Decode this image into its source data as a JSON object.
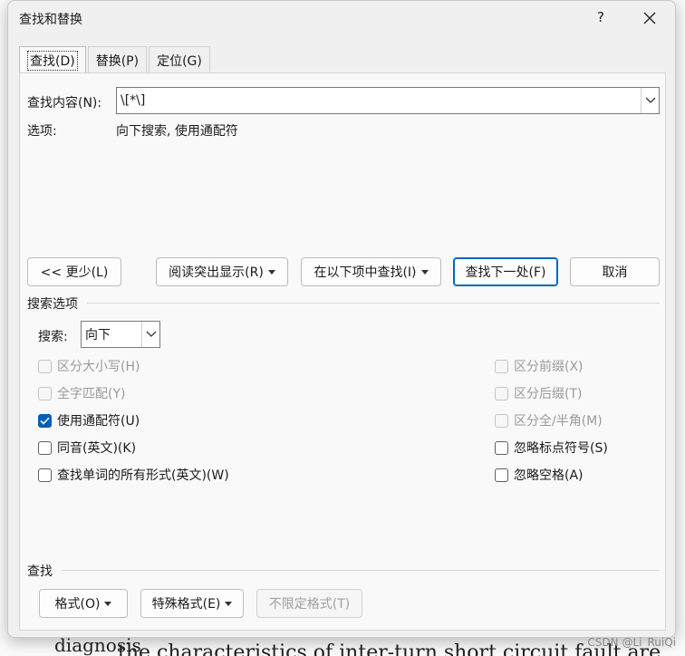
{
  "dialog": {
    "title": "查找和替换",
    "help_label": "?",
    "close_icon": "close-icon"
  },
  "tabs": [
    {
      "label": "查找(D)",
      "active": true
    },
    {
      "label": "替换(P)",
      "active": false
    },
    {
      "label": "定位(G)",
      "active": false
    }
  ],
  "find": {
    "label": "查找内容(N):",
    "value": "\\[*\\]",
    "options_label": "选项:",
    "options_value": "向下搜索, 使用通配符"
  },
  "buttons": {
    "less": "<< 更少(L)",
    "highlight": "阅读突出显示(R)",
    "find_in": "在以下项中查找(I)",
    "find_next": "查找下一处(F)",
    "cancel": "取消"
  },
  "search_options": {
    "section_label": "搜索选项",
    "search_label": "搜索:",
    "search_value": "向下"
  },
  "checkboxes_left": [
    {
      "label": "区分大小写(H)",
      "checked": false,
      "disabled": true
    },
    {
      "label": "全字匹配(Y)",
      "checked": false,
      "disabled": true
    },
    {
      "label": "使用通配符(U)",
      "checked": true,
      "disabled": false
    },
    {
      "label": "同音(英文)(K)",
      "checked": false,
      "disabled": false
    },
    {
      "label": "查找单词的所有形式(英文)(W)",
      "checked": false,
      "disabled": false
    }
  ],
  "checkboxes_right": [
    {
      "label": "区分前缀(X)",
      "checked": false,
      "disabled": true
    },
    {
      "label": "区分后缀(T)",
      "checked": false,
      "disabled": true
    },
    {
      "label": "区分全/半角(M)",
      "checked": false,
      "disabled": true
    },
    {
      "label": "忽略标点符号(S)",
      "checked": false,
      "disabled": false
    },
    {
      "label": "忽略空格(A)",
      "checked": false,
      "disabled": false
    }
  ],
  "find_section": {
    "section_label": "查找",
    "format": "格式(O)",
    "special": "特殊格式(E)",
    "no_format": "不限定格式(T)"
  },
  "watermark": "CSDN @Li_RuiQi",
  "background_text": {
    "bottom_left": "diagnosis",
    "bottom_line": "the characteristics of inter-turn short circuit fault are obtained"
  },
  "colors": {
    "accent": "#005fb8",
    "primary_border": "#0067c0"
  }
}
